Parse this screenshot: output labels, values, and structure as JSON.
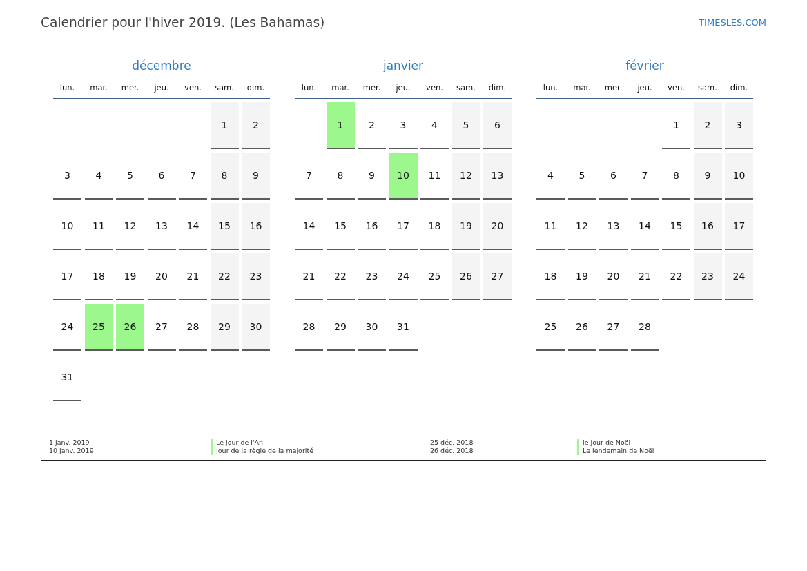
{
  "title": "Calendrier pour l'hiver 2019. (Les Bahamas)",
  "site_link": "TIMESLES.COM",
  "months": [
    {
      "name": "décembre",
      "weekdays": [
        "lun.",
        "mar.",
        "mer.",
        "jeu.",
        "ven.",
        "sam.",
        "dim."
      ],
      "weeks": [
        [
          {
            "kind": "blank"
          },
          {
            "kind": "blank"
          },
          {
            "kind": "blank"
          },
          {
            "kind": "blank"
          },
          {
            "kind": "blank"
          },
          {
            "day": "1",
            "kind": "weekend"
          },
          {
            "day": "2",
            "kind": "weekend"
          }
        ],
        [
          {
            "day": "3",
            "kind": "weekday"
          },
          {
            "day": "4",
            "kind": "weekday"
          },
          {
            "day": "5",
            "kind": "weekday"
          },
          {
            "day": "6",
            "kind": "weekday"
          },
          {
            "day": "7",
            "kind": "weekday"
          },
          {
            "day": "8",
            "kind": "weekend"
          },
          {
            "day": "9",
            "kind": "weekend"
          }
        ],
        [
          {
            "day": "10",
            "kind": "weekday"
          },
          {
            "day": "11",
            "kind": "weekday"
          },
          {
            "day": "12",
            "kind": "weekday"
          },
          {
            "day": "13",
            "kind": "weekday"
          },
          {
            "day": "14",
            "kind": "weekday"
          },
          {
            "day": "15",
            "kind": "weekend"
          },
          {
            "day": "16",
            "kind": "weekend"
          }
        ],
        [
          {
            "day": "17",
            "kind": "weekday"
          },
          {
            "day": "18",
            "kind": "weekday"
          },
          {
            "day": "19",
            "kind": "weekday"
          },
          {
            "day": "20",
            "kind": "weekday"
          },
          {
            "day": "21",
            "kind": "weekday"
          },
          {
            "day": "22",
            "kind": "weekend"
          },
          {
            "day": "23",
            "kind": "weekend"
          }
        ],
        [
          {
            "day": "24",
            "kind": "weekday"
          },
          {
            "day": "25",
            "kind": "holiday"
          },
          {
            "day": "26",
            "kind": "holiday"
          },
          {
            "day": "27",
            "kind": "weekday"
          },
          {
            "day": "28",
            "kind": "weekday"
          },
          {
            "day": "29",
            "kind": "weekend"
          },
          {
            "day": "30",
            "kind": "weekend"
          }
        ],
        [
          {
            "day": "31",
            "kind": "weekday"
          }
        ]
      ]
    },
    {
      "name": "janvier",
      "weekdays": [
        "lun.",
        "mar.",
        "mer.",
        "jeu.",
        "ven.",
        "sam.",
        "dim."
      ],
      "weeks": [
        [
          {
            "kind": "blank"
          },
          {
            "day": "1",
            "kind": "holiday"
          },
          {
            "day": "2",
            "kind": "weekday"
          },
          {
            "day": "3",
            "kind": "weekday"
          },
          {
            "day": "4",
            "kind": "weekday"
          },
          {
            "day": "5",
            "kind": "weekend"
          },
          {
            "day": "6",
            "kind": "weekend"
          }
        ],
        [
          {
            "day": "7",
            "kind": "weekday"
          },
          {
            "day": "8",
            "kind": "weekday"
          },
          {
            "day": "9",
            "kind": "weekday"
          },
          {
            "day": "10",
            "kind": "holiday"
          },
          {
            "day": "11",
            "kind": "weekday"
          },
          {
            "day": "12",
            "kind": "weekend"
          },
          {
            "day": "13",
            "kind": "weekend"
          }
        ],
        [
          {
            "day": "14",
            "kind": "weekday"
          },
          {
            "day": "15",
            "kind": "weekday"
          },
          {
            "day": "16",
            "kind": "weekday"
          },
          {
            "day": "17",
            "kind": "weekday"
          },
          {
            "day": "18",
            "kind": "weekday"
          },
          {
            "day": "19",
            "kind": "weekend"
          },
          {
            "day": "20",
            "kind": "weekend"
          }
        ],
        [
          {
            "day": "21",
            "kind": "weekday"
          },
          {
            "day": "22",
            "kind": "weekday"
          },
          {
            "day": "23",
            "kind": "weekday"
          },
          {
            "day": "24",
            "kind": "weekday"
          },
          {
            "day": "25",
            "kind": "weekday"
          },
          {
            "day": "26",
            "kind": "weekend"
          },
          {
            "day": "27",
            "kind": "weekend"
          }
        ],
        [
          {
            "day": "28",
            "kind": "weekday"
          },
          {
            "day": "29",
            "kind": "weekday"
          },
          {
            "day": "30",
            "kind": "weekday"
          },
          {
            "day": "31",
            "kind": "weekday"
          }
        ]
      ]
    },
    {
      "name": "février",
      "weekdays": [
        "lun.",
        "mar.",
        "mer.",
        "jeu.",
        "ven.",
        "sam.",
        "dim."
      ],
      "weeks": [
        [
          {
            "kind": "blank"
          },
          {
            "kind": "blank"
          },
          {
            "kind": "blank"
          },
          {
            "kind": "blank"
          },
          {
            "day": "1",
            "kind": "weekday"
          },
          {
            "day": "2",
            "kind": "weekend"
          },
          {
            "day": "3",
            "kind": "weekend"
          }
        ],
        [
          {
            "day": "4",
            "kind": "weekday"
          },
          {
            "day": "5",
            "kind": "weekday"
          },
          {
            "day": "6",
            "kind": "weekday"
          },
          {
            "day": "7",
            "kind": "weekday"
          },
          {
            "day": "8",
            "kind": "weekday"
          },
          {
            "day": "9",
            "kind": "weekend"
          },
          {
            "day": "10",
            "kind": "weekend"
          }
        ],
        [
          {
            "day": "11",
            "kind": "weekday"
          },
          {
            "day": "12",
            "kind": "weekday"
          },
          {
            "day": "13",
            "kind": "weekday"
          },
          {
            "day": "14",
            "kind": "weekday"
          },
          {
            "day": "15",
            "kind": "weekday"
          },
          {
            "day": "16",
            "kind": "weekend"
          },
          {
            "day": "17",
            "kind": "weekend"
          }
        ],
        [
          {
            "day": "18",
            "kind": "weekday"
          },
          {
            "day": "19",
            "kind": "weekday"
          },
          {
            "day": "20",
            "kind": "weekday"
          },
          {
            "day": "21",
            "kind": "weekday"
          },
          {
            "day": "22",
            "kind": "weekday"
          },
          {
            "day": "23",
            "kind": "weekend"
          },
          {
            "day": "24",
            "kind": "weekend"
          }
        ],
        [
          {
            "day": "25",
            "kind": "weekday"
          },
          {
            "day": "26",
            "kind": "weekday"
          },
          {
            "day": "27",
            "kind": "weekday"
          },
          {
            "day": "28",
            "kind": "weekday"
          }
        ]
      ]
    }
  ],
  "legend": {
    "columns": [
      [
        {
          "date": "1 janv. 2019",
          "name": "Le jour de l'An"
        },
        {
          "date": "10 janv. 2019",
          "name": "Jour de la règle de la majorité"
        }
      ],
      [
        {
          "date": "25 déc. 2018",
          "name": "le jour de Noël"
        },
        {
          "date": "26 déc. 2018",
          "name": "Le lendemain de Noël"
        }
      ]
    ]
  }
}
